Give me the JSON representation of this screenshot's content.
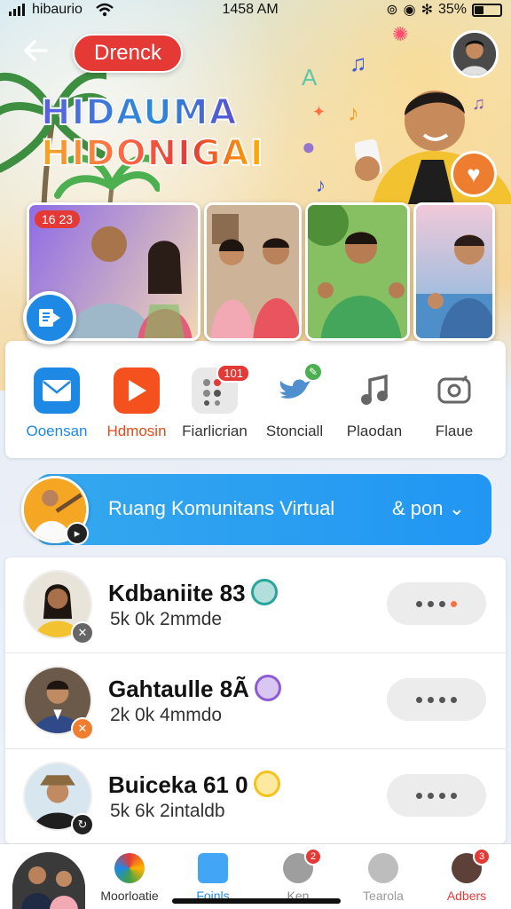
{
  "status_bar": {
    "carrier": "hibaurio",
    "time": "1458 AM",
    "battery": "35%",
    "battery_level": 0.35
  },
  "header": {
    "title_pill": "Drenck",
    "headline_line1": "HIDAUMA",
    "headline_line2": "HIDONIGAI"
  },
  "video_strip": {
    "cards": [
      {
        "tag": "16 23",
        "tag_color": "#e53935"
      },
      {
        "tag": "",
        "tag_color": ""
      },
      {
        "tag": "",
        "tag_color": "#555555"
      },
      {
        "tag": "",
        "tag_color": "#ef7d2f"
      }
    ]
  },
  "apps": [
    {
      "label": "Ooensan",
      "icon": "mail-icon",
      "color": "#1e88e5",
      "badge": ""
    },
    {
      "label": "Hdmosin",
      "icon": "play-icon",
      "color": "#f4511e",
      "badge": ""
    },
    {
      "label": "Fiarlicrian",
      "icon": "dots-grid-icon",
      "color": "#9e9e9e",
      "badge": "101"
    },
    {
      "label": "Stonciall",
      "icon": "bird-icon",
      "color": "#42a5f5",
      "badge": ""
    },
    {
      "label": "Plaodan",
      "icon": "music-note-icon",
      "color": "#616161",
      "badge": ""
    },
    {
      "label": "Flaue",
      "icon": "camera-icon",
      "color": "#616161",
      "badge": ""
    }
  ],
  "community_banner": {
    "title": "Ruang Komunitans Virtual",
    "action": "& pon"
  },
  "list": [
    {
      "name": "Kdbaniite 83",
      "sub": "5k 0k 2mmde",
      "badge_color": "#26a69a"
    },
    {
      "name": "Gahtaulle 8Ã",
      "sub": "2k 0k 4mmdo",
      "badge_color": "#8e5bd6"
    },
    {
      "name": "Buiceka 61 0",
      "sub": "5k 6k 2intaldb",
      "badge_color": "#f6c21c"
    }
  ],
  "bottom_nav": [
    {
      "label": "",
      "icon": "profile-avatar"
    },
    {
      "label": "Moorloatie",
      "icon": "compass-icon",
      "badge": ""
    },
    {
      "label": "Foinls",
      "icon": "edit-icon",
      "badge": ""
    },
    {
      "label": "Ken",
      "icon": "chat-icon",
      "badge": "2"
    },
    {
      "label": "Tearola",
      "icon": "globe-icon",
      "badge": ""
    },
    {
      "label": "Adbers",
      "icon": "user-avatar",
      "badge": "3"
    }
  ],
  "colors": {
    "accent_blue": "#2196f3",
    "accent_red": "#e53935",
    "accent_orange": "#ef7d2f"
  }
}
